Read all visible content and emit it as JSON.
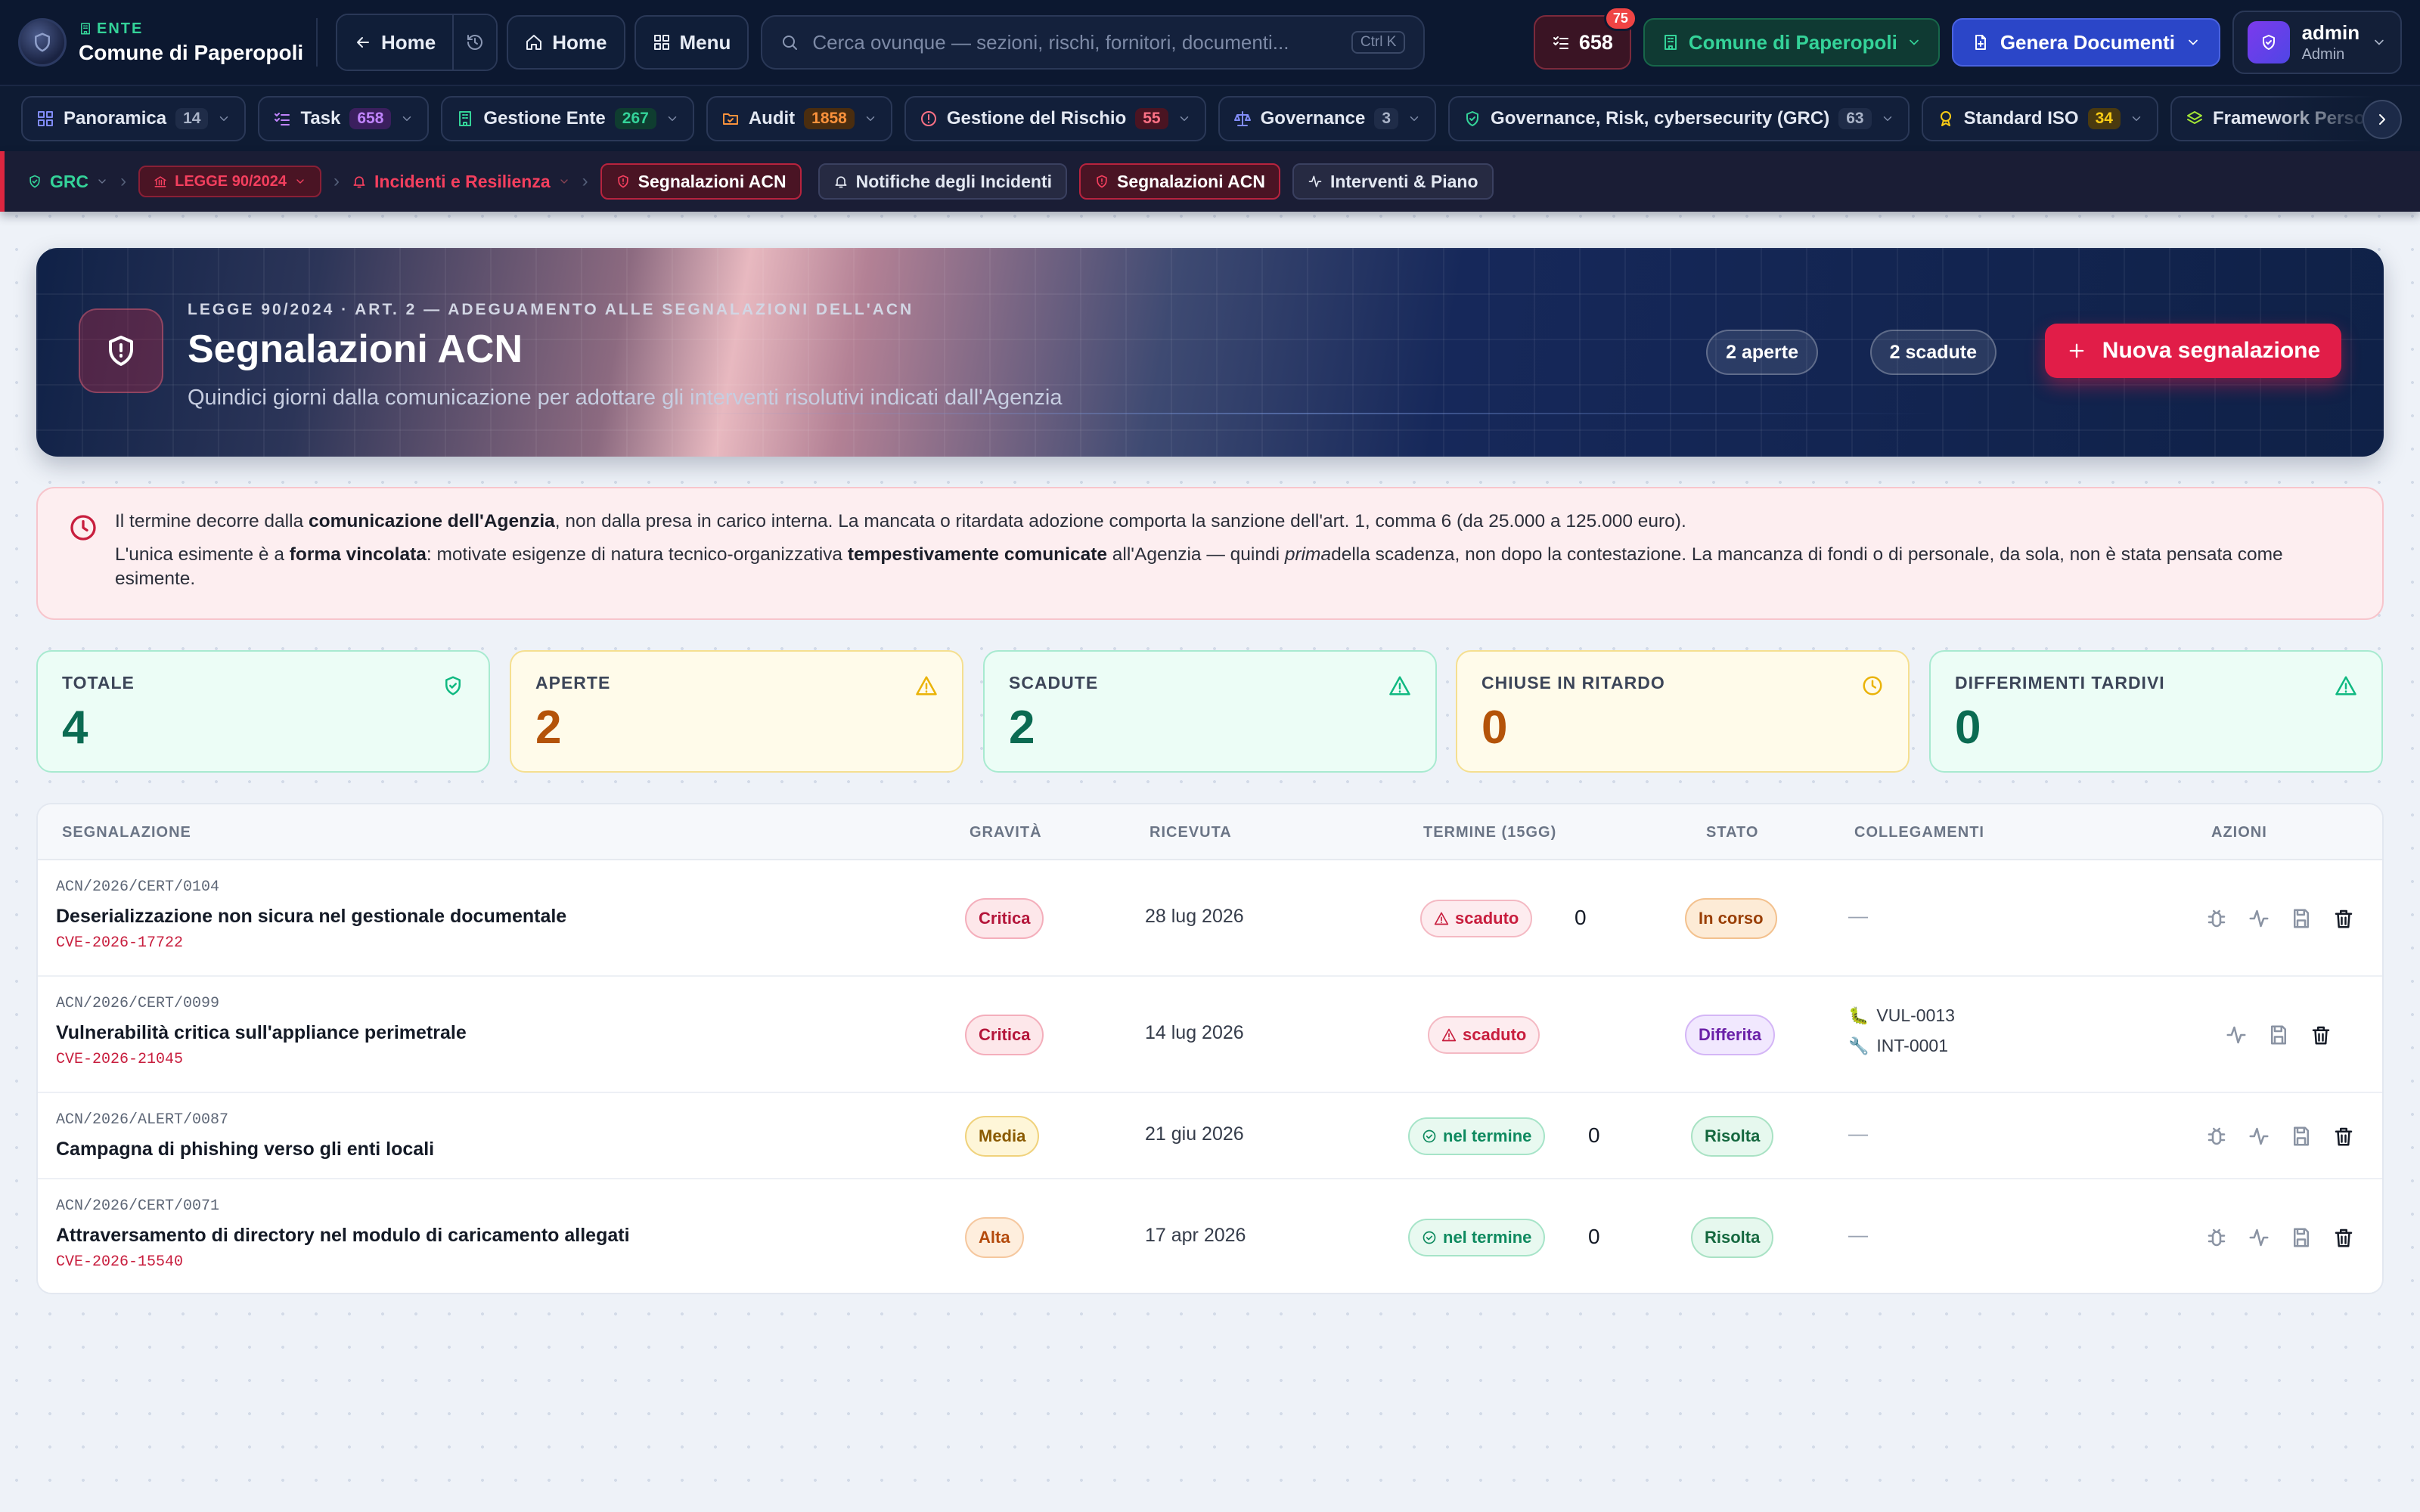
{
  "topbar": {
    "ente_label": "ENTE",
    "ente_name": "Comune di Paperopoli",
    "back_label": "Home",
    "home_label": "Home",
    "menu_label": "Menu",
    "search_placeholder": "Cerca ovunque — sezioni, rischi, fornitori, documenti...",
    "search_shortcut": "Ctrl K",
    "tasks_count": "658",
    "notif_count": "75",
    "ente_selector": "Comune di Paperopoli",
    "genera_label": "Genera Documenti",
    "user_name": "admin",
    "user_role": "Admin"
  },
  "modules": [
    {
      "label": "Panoramica",
      "count": "14",
      "icon": "grid-icon",
      "count_bg": "#1f2c48",
      "count_fg": "#aab4c8"
    },
    {
      "label": "Task",
      "count": "658",
      "icon": "checklist-icon",
      "count_bg": "#3b1f5e",
      "count_fg": "#c084fc"
    },
    {
      "label": "Gestione Ente",
      "count": "267",
      "icon": "building-icon",
      "count_bg": "#0f3d30",
      "count_fg": "#34d399"
    },
    {
      "label": "Audit",
      "count": "1858",
      "icon": "folder-icon",
      "count_bg": "#4a2d0f",
      "count_fg": "#fb923c"
    },
    {
      "label": "Gestione del Rischio",
      "count": "55",
      "icon": "alert-circle-icon",
      "count_bg": "#4a1422",
      "count_fg": "#fb7185"
    },
    {
      "label": "Governance",
      "count": "3",
      "icon": "scale-icon",
      "count_bg": "#1f2c48",
      "count_fg": "#aab4c8"
    },
    {
      "label": "Governance, Risk, cybersecurity (GRC)",
      "count": "63",
      "icon": "shield-check-icon",
      "count_bg": "#1f2c48",
      "count_fg": "#aab4c8"
    },
    {
      "label": "Standard ISO",
      "count": "34",
      "icon": "award-icon",
      "count_bg": "#4a3a0f",
      "count_fg": "#facc15"
    },
    {
      "label": "Framework Personalizzati",
      "count": "",
      "icon": "layers-icon",
      "count_bg": "",
      "count_fg": ""
    }
  ],
  "breadcrumb": {
    "grc": "GRC",
    "legge": "LEGGE 90/2024",
    "incidenti": "Incidenti e Resilienza",
    "current": "Segnalazioni ACN",
    "tabs": [
      "Notifiche degli Incidenti",
      "Segnalazioni ACN",
      "Interventi & Piano"
    ]
  },
  "hero": {
    "kicker": "LEGGE 90/2024 · ART. 2 — ADEGUAMENTO ALLE SEGNALAZIONI DELL'ACN",
    "title": "Segnalazioni ACN",
    "subtitle": "Quindici giorni dalla comunicazione per adottare gli interventi risolutivi indicati dall'Agenzia",
    "pill_open": "2 aperte",
    "pill_expired": "2 scadute",
    "new_button": "Nuova segnalazione"
  },
  "warning": {
    "l1a": "Il termine decorre dalla ",
    "l1b": "comunicazione dell'Agenzia",
    "l1c": ", non dalla presa in carico interna. La mancata o ritardata adozione comporta la sanzione dell'art. 1, comma 6 (da 25.000 a 125.000 euro).",
    "l2a": "L'unica esimente è a ",
    "l2b": "forma vincolata",
    "l2c": ": motivate esigenze di natura tecnico-organizzativa ",
    "l2d": "tempestivamente comunicate",
    "l2e": " all'Agenzia — quindi ",
    "l2f": "prima",
    "l2g": "della scadenza, non dopo la contestazione. La mancanza di fondi o di personale, da sola, non è stata pensata come esimente."
  },
  "stats": [
    {
      "label": "TOTALE",
      "value": "4"
    },
    {
      "label": "APERTE",
      "value": "2"
    },
    {
      "label": "SCADUTE",
      "value": "2"
    },
    {
      "label": "CHIUSE IN RITARDO",
      "value": "0"
    },
    {
      "label": "DIFFERIMENTI TARDIVI",
      "value": "0"
    }
  ],
  "table": {
    "headers": [
      "SEGNALAZIONE",
      "GRAVITÀ",
      "RICEVUTA",
      "TERMINE (15GG)",
      "STATO",
      "COLLEGAMENTI",
      "AZIONI"
    ],
    "rows": [
      {
        "code": "ACN/2026/CERT/0104",
        "title": "Deserializzazione non sicura nel gestionale documentale",
        "cve": "CVE-2026-17722",
        "severity": "Critica",
        "received": "28 lug 2026",
        "term": "scaduto",
        "term_extra": "0",
        "state": "In corso",
        "links": "—"
      },
      {
        "code": "ACN/2026/CERT/0099",
        "title": "Vulnerabilità critica sull'appliance perimetrale",
        "cve": "CVE-2026-21045",
        "severity": "Critica",
        "received": "14 lug 2026",
        "term": "scaduto",
        "term_extra": "",
        "state": "Differita",
        "link1": "VUL-0013",
        "link2": "INT-0001"
      },
      {
        "code": "ACN/2026/ALERT/0087",
        "title": "Campagna di phishing verso gli enti locali",
        "cve": "",
        "severity": "Media",
        "received": "21 giu 2026",
        "term": "nel termine",
        "term_extra": "0",
        "state": "Risolta",
        "links": "—"
      },
      {
        "code": "ACN/2026/CERT/0071",
        "title": "Attraversamento di directory nel modulo di caricamento allegati",
        "cve": "CVE-2026-15540",
        "severity": "Alta",
        "received": "17 apr 2026",
        "term": "nel termine",
        "term_extra": "0",
        "state": "Risolta",
        "links": "—"
      }
    ]
  }
}
